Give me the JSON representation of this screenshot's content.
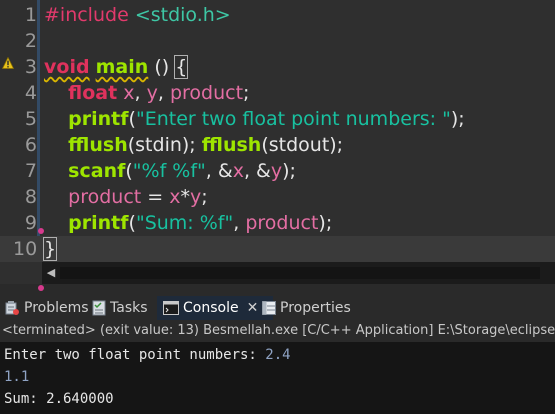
{
  "editor": {
    "lines": [
      {
        "n": "1",
        "tokens": [
          {
            "t": "#include",
            "c": "pp"
          },
          {
            "t": " "
          },
          {
            "t": "<stdio.h>",
            "c": "inc"
          }
        ]
      },
      {
        "n": "2",
        "tokens": []
      },
      {
        "n": "3",
        "tokens": [
          {
            "t": "void",
            "c": "kw warn-squiggle"
          },
          {
            "t": " "
          },
          {
            "t": "main",
            "c": "fn warn-squiggle"
          },
          {
            "t": " ("
          },
          {
            "t": ")"
          },
          {
            "t": " "
          },
          {
            "t": "{",
            "c": "bracket-box"
          }
        ]
      },
      {
        "n": "4",
        "tokens": [
          {
            "t": "    "
          },
          {
            "t": "float",
            "c": "kw"
          },
          {
            "t": " "
          },
          {
            "t": "x",
            "c": "var"
          },
          {
            "t": ", "
          },
          {
            "t": "y",
            "c": "var"
          },
          {
            "t": ", "
          },
          {
            "t": "product",
            "c": "var"
          },
          {
            "t": ";"
          }
        ]
      },
      {
        "n": "5",
        "tokens": [
          {
            "t": "    "
          },
          {
            "t": "printf",
            "c": "fn"
          },
          {
            "t": "("
          },
          {
            "t": "\"Enter two float point numbers: \"",
            "c": "str"
          },
          {
            "t": ");"
          }
        ]
      },
      {
        "n": "6",
        "tokens": [
          {
            "t": "    "
          },
          {
            "t": "fflush",
            "c": "fn"
          },
          {
            "t": "(stdin); "
          },
          {
            "t": "fflush",
            "c": "fn"
          },
          {
            "t": "(stdout);"
          }
        ]
      },
      {
        "n": "7",
        "tokens": [
          {
            "t": "    "
          },
          {
            "t": "scanf",
            "c": "fn"
          },
          {
            "t": "("
          },
          {
            "t": "\"%f %f\"",
            "c": "str"
          },
          {
            "t": ", &"
          },
          {
            "t": "x",
            "c": "var"
          },
          {
            "t": ", &"
          },
          {
            "t": "y",
            "c": "var"
          },
          {
            "t": ");"
          }
        ]
      },
      {
        "n": "8",
        "tokens": [
          {
            "t": "    "
          },
          {
            "t": "product",
            "c": "var"
          },
          {
            "t": " = "
          },
          {
            "t": "x",
            "c": "var"
          },
          {
            "t": "*"
          },
          {
            "t": "y",
            "c": "var"
          },
          {
            "t": ";"
          }
        ]
      },
      {
        "n": "9",
        "tokens": [
          {
            "t": "    "
          },
          {
            "t": "printf",
            "c": "fn"
          },
          {
            "t": "("
          },
          {
            "t": "\"Sum: %f\"",
            "c": "str"
          },
          {
            "t": ", "
          },
          {
            "t": "product",
            "c": "var"
          },
          {
            "t": ");"
          }
        ]
      },
      {
        "n": "10",
        "tokens": [
          {
            "t": "}",
            "c": "bracket-box"
          }
        ]
      }
    ],
    "current_line": 10,
    "warning_line": 3
  },
  "tabs": {
    "problems": "Problems",
    "tasks": "Tasks",
    "console": "Console",
    "properties": "Properties",
    "active": "console"
  },
  "console": {
    "header": "<terminated> (exit value: 13) Besmellah.exe [C/C++ Application] E:\\Storage\\eclipse",
    "output": [
      [
        {
          "t": "Enter two float point numbers: "
        },
        {
          "t": "2.4",
          "c": "cin"
        }
      ],
      [
        {
          "t": "1.1",
          "c": "cin"
        }
      ],
      [
        {
          "t": "Sum: 2.640000"
        }
      ]
    ]
  },
  "colors": {
    "keyword": "#e0325d",
    "function": "#9ee500",
    "string": "#18c1a0",
    "variable": "#e36ea3",
    "console_input": "#8fa3c4"
  },
  "icons": {
    "warning": "warning-icon",
    "problems": "problems-icon",
    "tasks": "tasks-icon",
    "console": "console-icon",
    "properties": "properties-icon",
    "close": "close-icon",
    "scroll_left": "chevron-left-icon"
  }
}
